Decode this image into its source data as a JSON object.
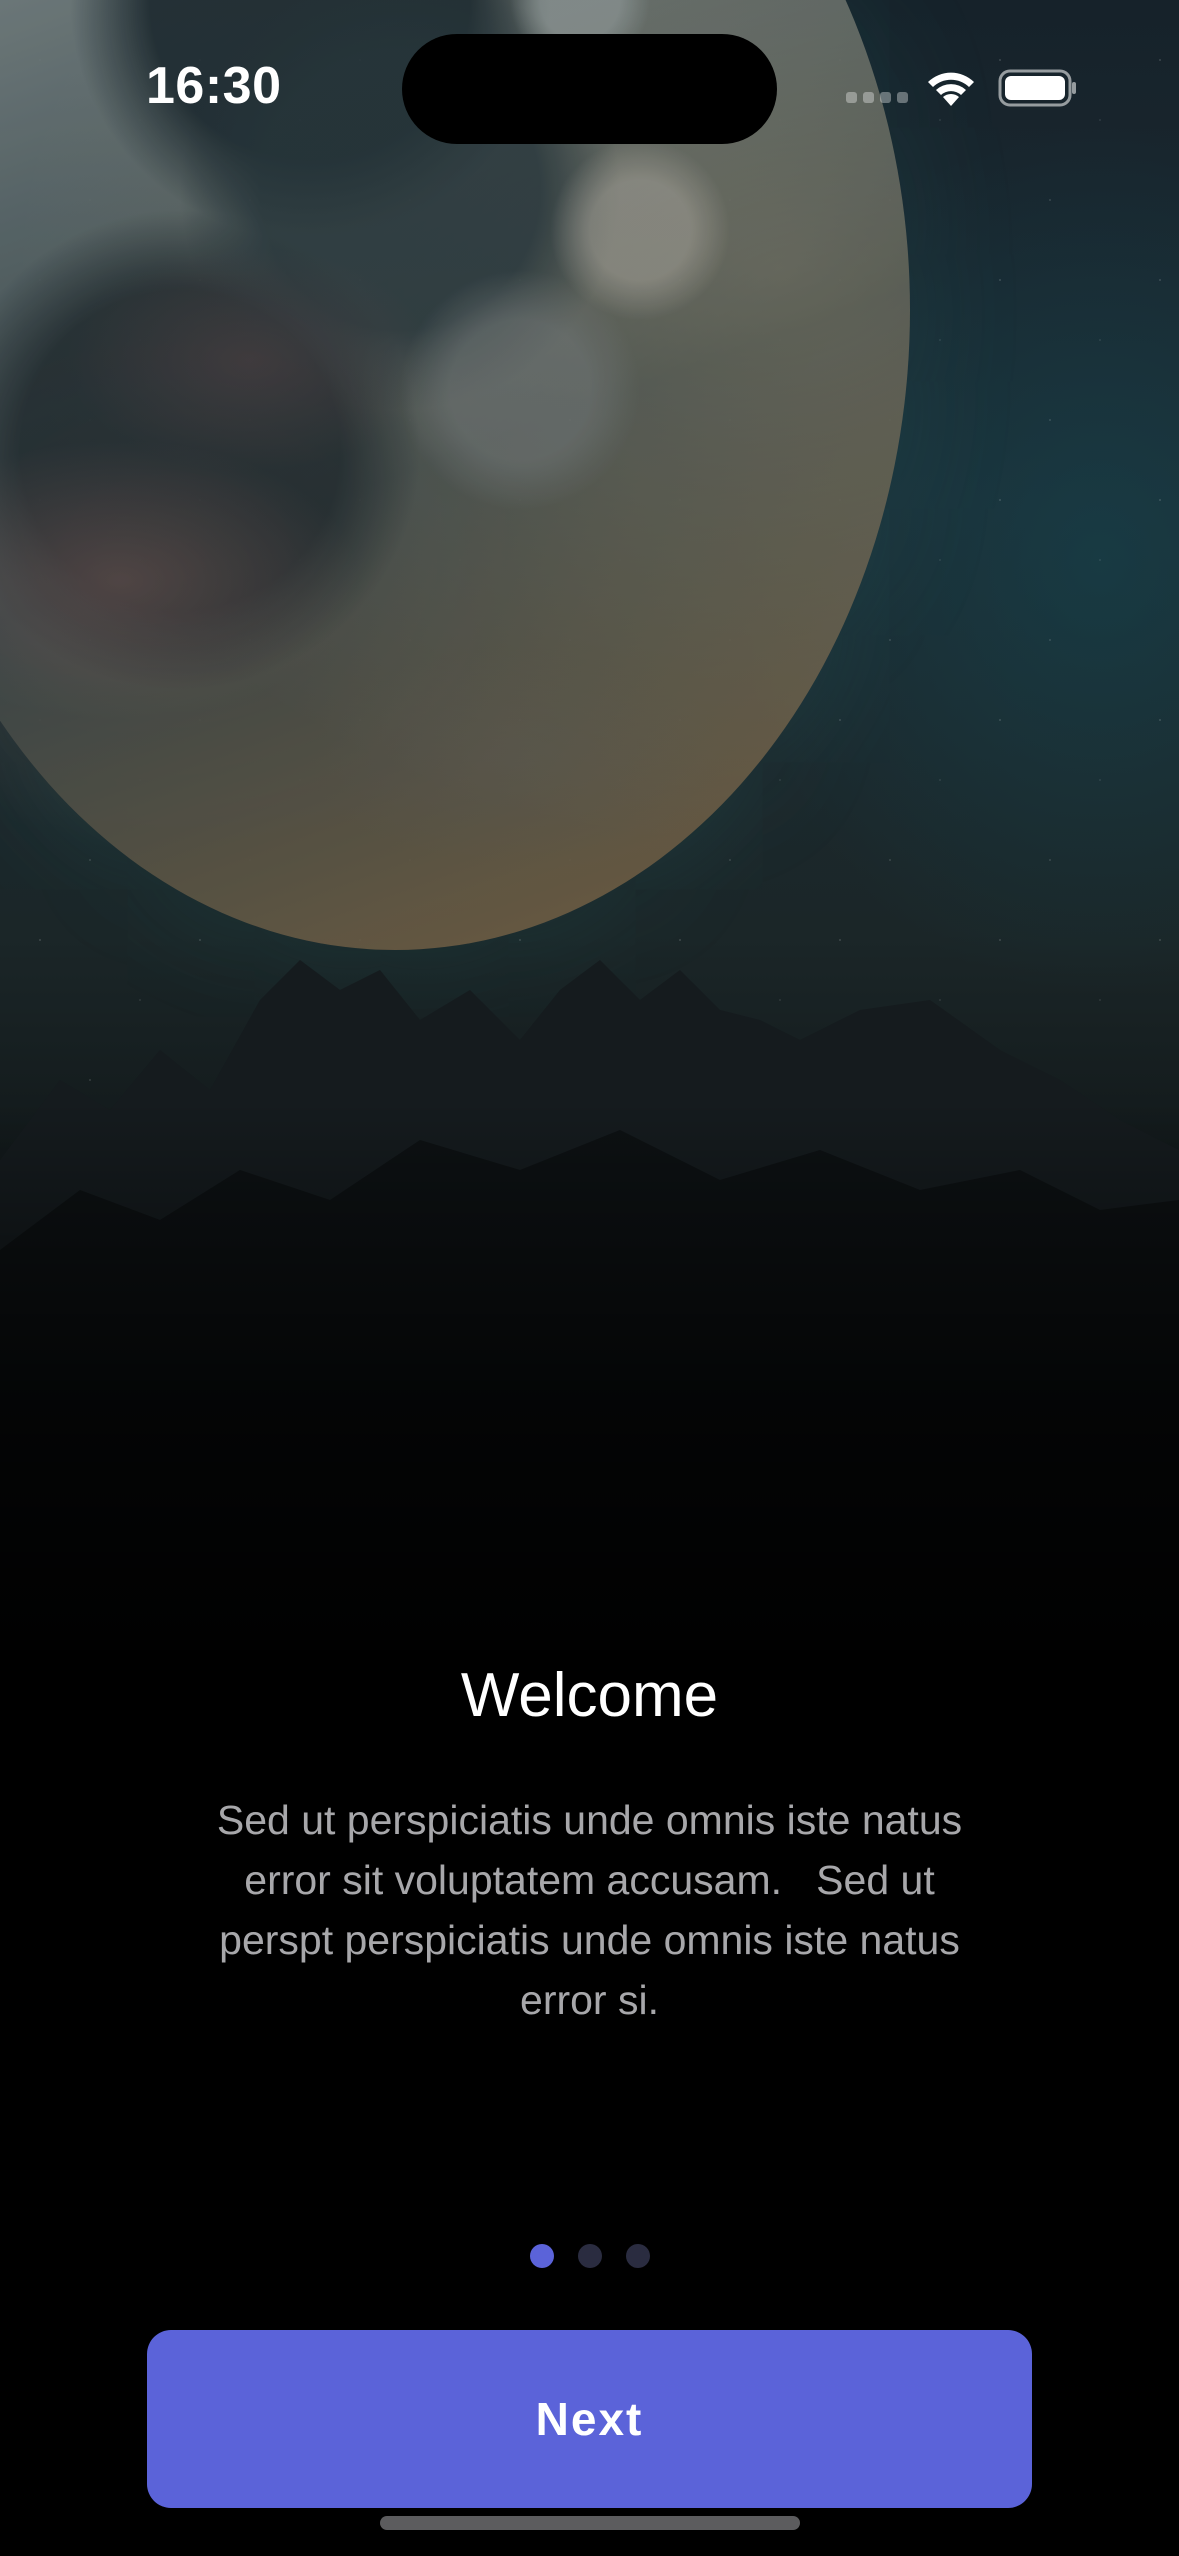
{
  "status_bar": {
    "time": "16:30",
    "icons": [
      "signal-icon",
      "wifi-icon",
      "battery-icon"
    ]
  },
  "background": {
    "description_icon": "moon-landscape-illustration"
  },
  "onboarding": {
    "title": "Welcome",
    "body": "Sed ut perspiciatis unde omnis iste natus\nerror sit voluptatem accusam.   Sed ut\nperspt perspiciatis unde omnis iste natus\nerror si.",
    "page_indicator": {
      "current": 1,
      "total": 3
    },
    "next_button_label": "Next"
  },
  "colors": {
    "accent": "#5b63d9",
    "inactive_dot": "#2a2c40",
    "title_text": "#ffffff",
    "body_text": "#a7a7aa",
    "background": "#000000"
  }
}
